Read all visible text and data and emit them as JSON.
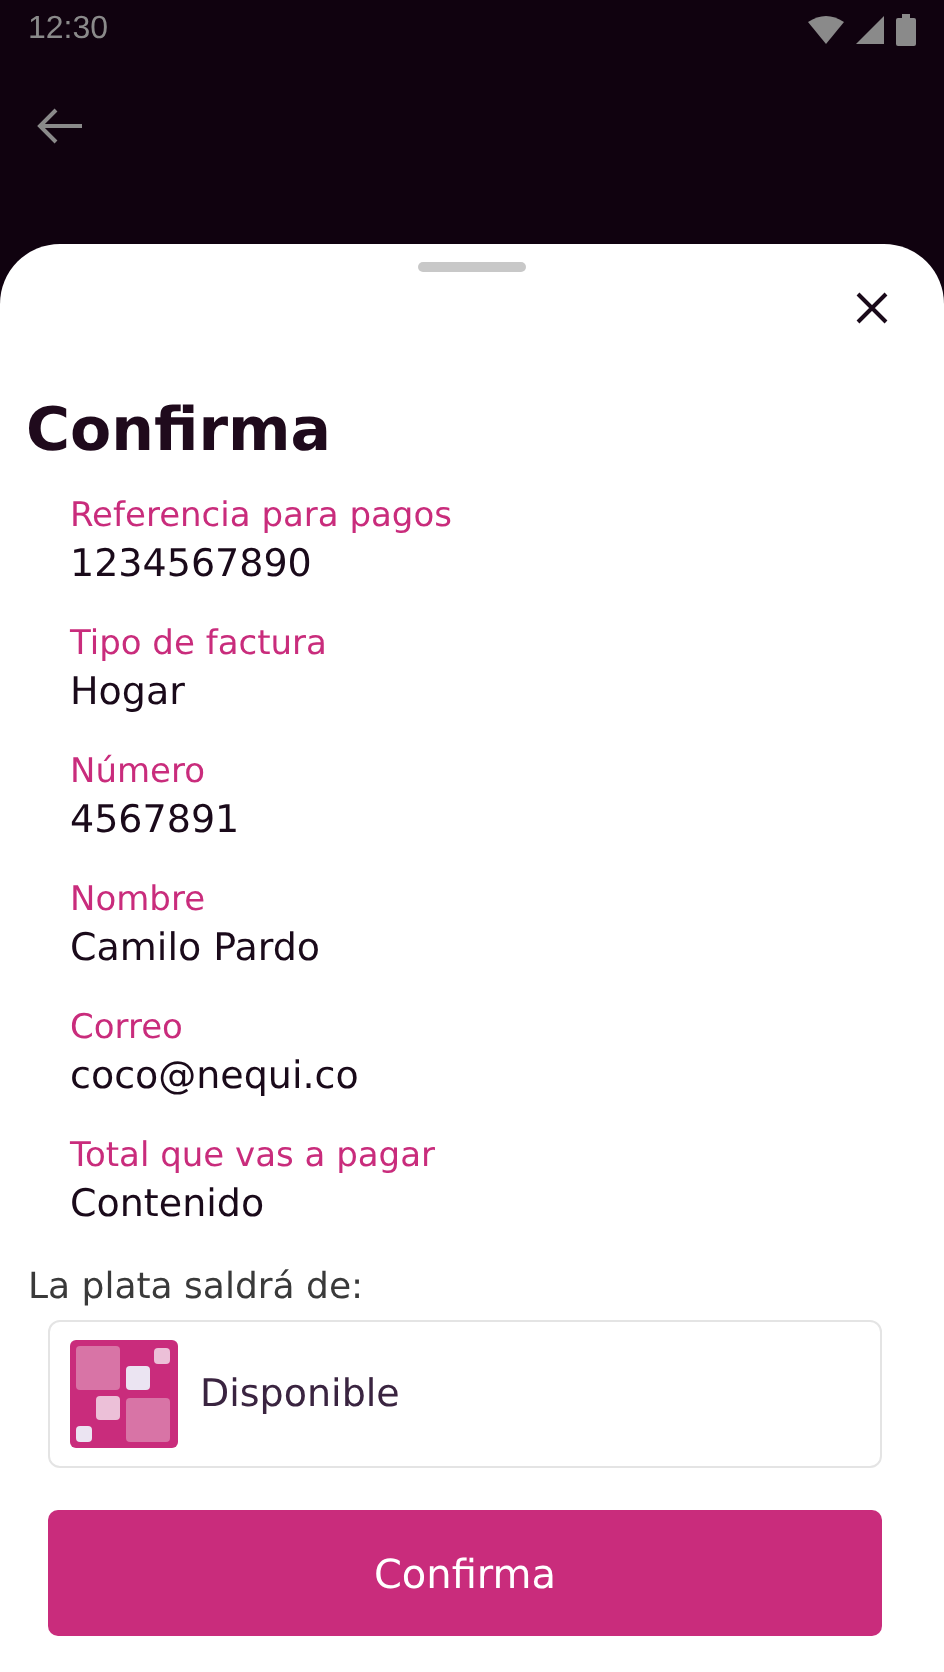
{
  "status_bar": {
    "time": "12:30"
  },
  "sheet": {
    "title": "Confirma",
    "fields": [
      {
        "label": "Referencia para pagos",
        "value": "1234567890"
      },
      {
        "label": "Tipo de factura",
        "value": "Hogar"
      },
      {
        "label": "Número",
        "value": "4567891"
      },
      {
        "label": "Nombre",
        "value": "Camilo Pardo"
      },
      {
        "label": "Correo",
        "value": "coco@nequi.co"
      },
      {
        "label": "Total que vas a pagar",
        "value": "Contenido"
      }
    ],
    "source_label": "La plata saldrá de:",
    "source": {
      "name": "Disponible"
    },
    "button": "Confirma"
  }
}
